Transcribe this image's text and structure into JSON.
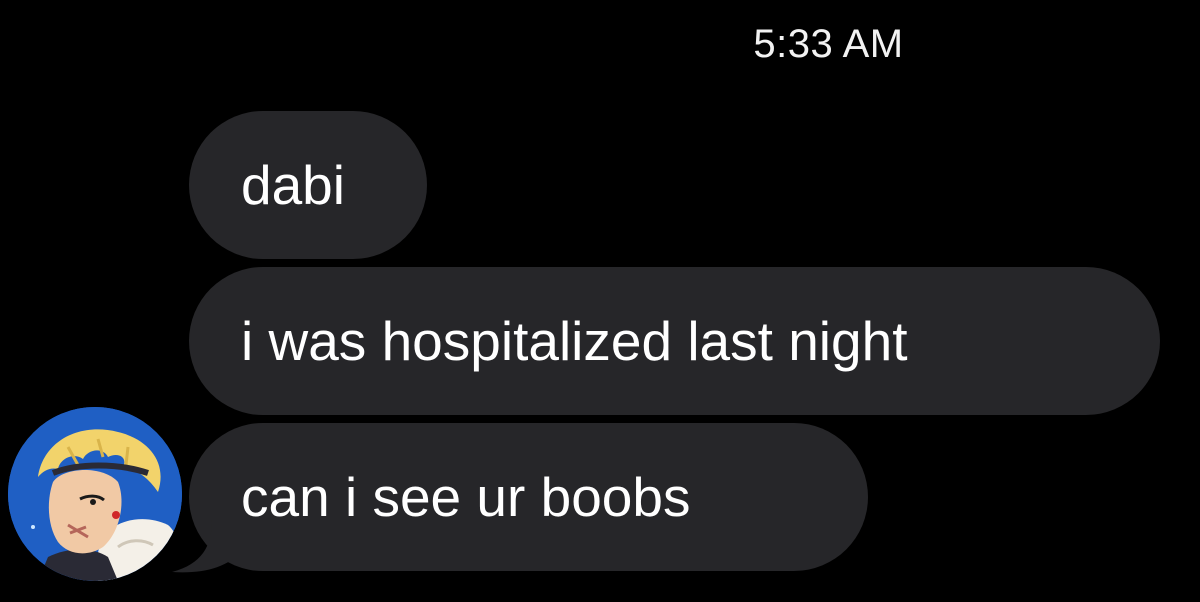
{
  "header": {
    "timestamp": "5:33 AM"
  },
  "messages": [
    {
      "text": "dabi"
    },
    {
      "text": "i was hospitalized last night"
    },
    {
      "text": "can i see ur boobs"
    }
  ],
  "avatar": {
    "icon": "contact-avatar-icon",
    "colors": {
      "background": "#1f5fc4",
      "hair": "#f2d36b",
      "skin": "#f1c9a5",
      "fur": "#f4f0e8"
    }
  },
  "colors": {
    "background": "#000000",
    "bubble": "#262629",
    "text": "#ffffff"
  }
}
